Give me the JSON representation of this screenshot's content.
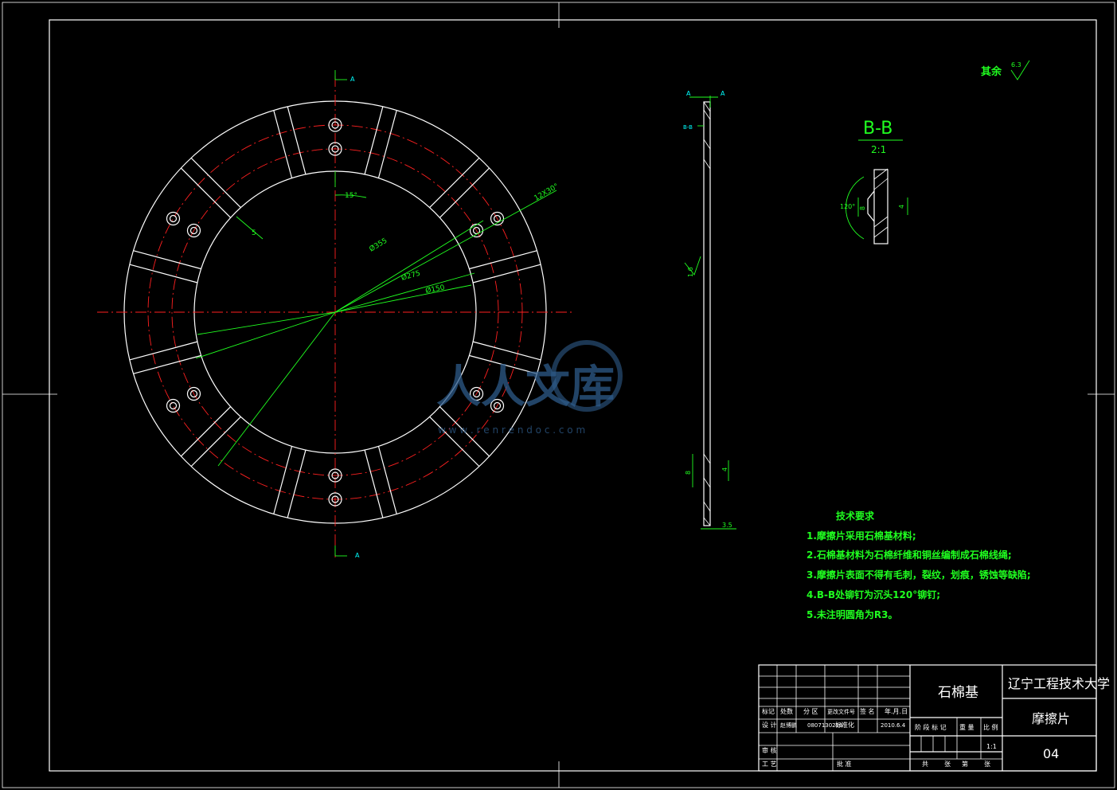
{
  "drawing": {
    "dimensions": {
      "d_outer": "Ø355",
      "d_pitch": "Ø275",
      "d_inner": "Ø150",
      "slot_width": "5",
      "slot_angle": "15°",
      "slot_count": "12X30°"
    },
    "section_marks": {
      "a_top": "A",
      "a_bottom": "A",
      "a_side_left": "A",
      "a_side_right": "A",
      "b_mark": "B-B"
    },
    "side_view": {
      "thickness": "3.5",
      "roughness": "1.6",
      "hole_8": "8",
      "hole_4": "4"
    },
    "detail": {
      "title": "B-B",
      "scale": "2:1",
      "angle": "120°",
      "dim_8": "8",
      "dim_4": "4"
    },
    "roughness_note": {
      "label": "其余",
      "value": "6.3"
    }
  },
  "tech_requirements": {
    "title": "技术要求",
    "items": [
      "1.摩擦片采用石棉基材料;",
      "2.石棉基材料为石棉纤维和铜丝编制成石棉线绳;",
      "3.摩擦片表面不得有毛刺，裂纹，划痕，锈蚀等缺陷;",
      "4.B-B处铆钉为沉头120°铆钉;",
      "5.未注明圆角为R3。"
    ]
  },
  "title_block": {
    "material": "石棉基",
    "university": "辽宁工程技术大学",
    "part_name": "摩擦片",
    "drawing_no": "04",
    "scale": "1:1",
    "hdr": {
      "mark": "标记",
      "count": "处数",
      "zone": "分 区",
      "doc": "更改文件号",
      "sign": "签 名",
      "date": "年.月.日"
    },
    "design": {
      "label": "设 计",
      "name": "赵博鹏",
      "id": "0807130229",
      "std": "标准化",
      "date": "2010.6.4"
    },
    "stage": {
      "label": "阶 段 标 记",
      "weight": "重 量",
      "ratio": "比 例"
    },
    "review": "审 核",
    "craft": "工 艺",
    "approve": "批 准",
    "sheets": {
      "total": "共",
      "zhang1": "张",
      "di": "第",
      "zhang2": "张"
    }
  },
  "watermark": {
    "brand": "人人文库",
    "url": "w w w . r e n r e n d o c . c o m"
  }
}
